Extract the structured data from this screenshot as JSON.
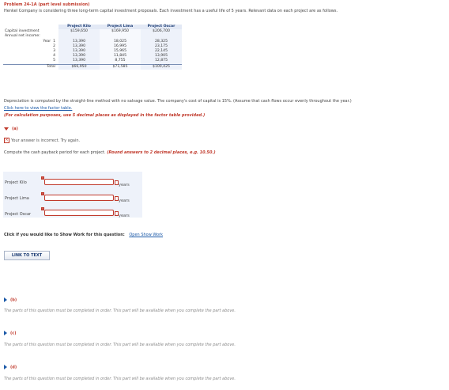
{
  "problem": {
    "title": "Problem 24-1A (part level submission)",
    "intro": "Henkel Company is considering three long-term capital investment proposals. Each investment has a useful life of 5 years. Relevant data on each project are as follows."
  },
  "table": {
    "headers": [
      "Project Kilo",
      "Project Lima",
      "Project Oscar"
    ],
    "capital_label": "Capital investment",
    "capital": [
      "$159,650",
      "$169,950",
      "$206,700"
    ],
    "annual_label": "Annual net income:",
    "year_label": "Year",
    "rows": [
      {
        "year": "1",
        "values": [
          "13,390",
          "18,025",
          "28,325"
        ]
      },
      {
        "year": "2",
        "values": [
          "13,390",
          "16,995",
          "23,175"
        ]
      },
      {
        "year": "3",
        "values": [
          "13,390",
          "15,965",
          "22,145"
        ]
      },
      {
        "year": "4",
        "values": [
          "13,390",
          "11,845",
          "13,905"
        ]
      },
      {
        "year": "5",
        "values": [
          "13,390",
          "8,755",
          "12,875"
        ]
      }
    ],
    "total_label": "Total",
    "totals": [
      "$66,950",
      "$71,585",
      "$100,425"
    ]
  },
  "notes": {
    "depreciation": "Depreciation is computed by the straight-line method with no salvage value. The company's cost of capital is 15%. (Assume that cash flows occur evenly throughout the year.)",
    "factor_link": "Click here to view the factor table.",
    "calc_note": "(For calculation purposes, use 5 decimal places as displayed in the factor table provided.)"
  },
  "part_a": {
    "label": "(a)",
    "incorrect": "Your answer is incorrect.  Try again.",
    "instruction": "Compute the cash payback period for each project.",
    "instruction_hint": "(Round answers to 2 decimal places, e.g. 10.50.)",
    "fields": [
      {
        "label": "Project Kilo",
        "value": "",
        "unit": "years"
      },
      {
        "label": "Project Lima",
        "value": "",
        "unit": "years"
      },
      {
        "label": "Project Oscar",
        "value": "",
        "unit": "years"
      }
    ],
    "show_work_prompt": "Click if you would like to Show Work for this question:",
    "show_work_link": "Open Show Work",
    "link_text_button": "LINK TO TEXT"
  },
  "locked_parts": [
    {
      "label": "(b)",
      "message": "The parts of this question must be completed in order. This part will be available when you complete the part above."
    },
    {
      "label": "(c)",
      "message": "The parts of this question must be completed in order. This part will be available when you complete the part above."
    },
    {
      "label": "(d)",
      "message": "The parts of this question must be completed in order. This part will be available when you complete the part above."
    }
  ],
  "colors": {
    "accent_red": "#c0392b",
    "link_blue": "#1c5aa8",
    "header_navy": "#1c3c74"
  }
}
